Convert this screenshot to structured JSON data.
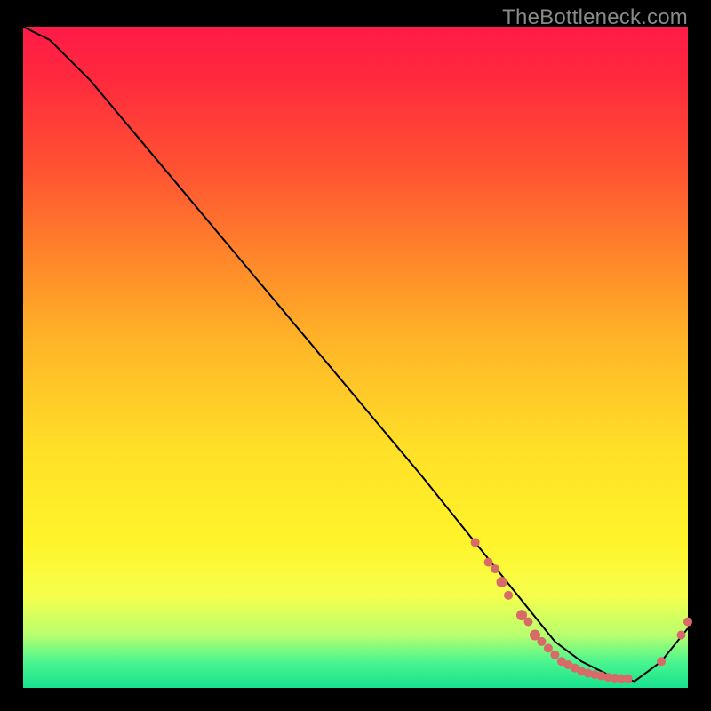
{
  "attribution": "TheBottleneck.com",
  "chart_data": {
    "type": "line",
    "title": "",
    "xlabel": "",
    "ylabel": "",
    "xlim": [
      0,
      100
    ],
    "ylim": [
      0,
      100
    ],
    "series": [
      {
        "name": "bottleneck-curve",
        "x": [
          0,
          4,
          10,
          20,
          30,
          40,
          50,
          60,
          68,
          72,
          76,
          80,
          84,
          88,
          92,
          96,
          100
        ],
        "y": [
          100,
          98,
          92,
          80,
          68,
          56,
          44,
          32,
          22,
          17,
          12,
          7,
          4,
          2,
          1,
          4,
          9
        ]
      }
    ],
    "markers": {
      "name": "highlight-points",
      "color": "#d86b68",
      "points": [
        {
          "x": 68,
          "y": 22,
          "r": 5
        },
        {
          "x": 70,
          "y": 19,
          "r": 5
        },
        {
          "x": 71,
          "y": 18,
          "r": 5
        },
        {
          "x": 72,
          "y": 16,
          "r": 6
        },
        {
          "x": 73,
          "y": 14,
          "r": 5
        },
        {
          "x": 75,
          "y": 11,
          "r": 6
        },
        {
          "x": 76,
          "y": 10,
          "r": 5
        },
        {
          "x": 77,
          "y": 8,
          "r": 6
        },
        {
          "x": 78,
          "y": 7,
          "r": 5
        },
        {
          "x": 79,
          "y": 6,
          "r": 5
        },
        {
          "x": 80,
          "y": 5,
          "r": 5
        },
        {
          "x": 81,
          "y": 4,
          "r": 5
        },
        {
          "x": 82,
          "y": 3.5,
          "r": 5
        },
        {
          "x": 83,
          "y": 3,
          "r": 5
        },
        {
          "x": 84,
          "y": 2.5,
          "r": 5
        },
        {
          "x": 85,
          "y": 2.2,
          "r": 5
        },
        {
          "x": 86,
          "y": 2,
          "r": 5
        },
        {
          "x": 87,
          "y": 1.8,
          "r": 5
        },
        {
          "x": 88,
          "y": 1.6,
          "r": 5
        },
        {
          "x": 89,
          "y": 1.5,
          "r": 5
        },
        {
          "x": 90,
          "y": 1.4,
          "r": 5
        },
        {
          "x": 91,
          "y": 1.4,
          "r": 5
        },
        {
          "x": 96,
          "y": 4,
          "r": 5
        },
        {
          "x": 99,
          "y": 8,
          "r": 5
        },
        {
          "x": 100,
          "y": 10,
          "r": 5
        }
      ]
    }
  }
}
